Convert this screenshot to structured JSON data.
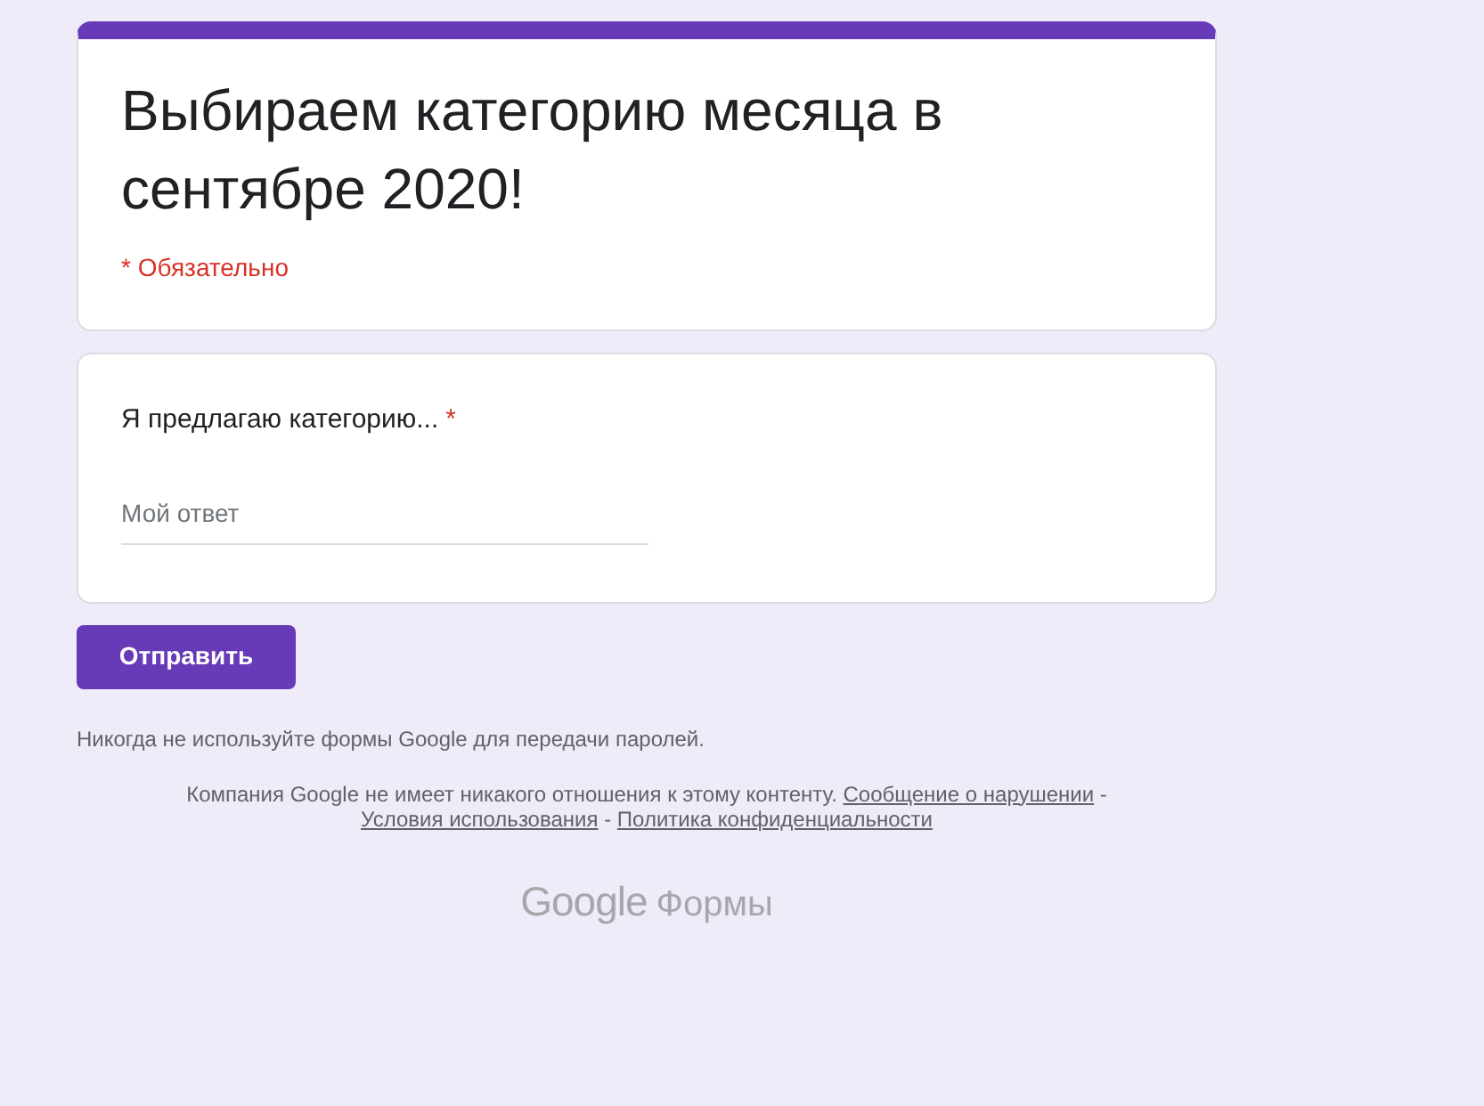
{
  "header": {
    "title": "Выбираем категорию месяца в сентябре 2020!",
    "required_note": "* Обязательно"
  },
  "questions": [
    {
      "label": "Я предлагаю категорию...",
      "required_mark": "*",
      "placeholder": "Мой ответ"
    }
  ],
  "submit_button": "Отправить",
  "password_warning": "Никогда не используйте формы Google для передачи паролей.",
  "legal": [
    {
      "kind": "text",
      "text": "Компания Google не имеет никакого отношения к этому контенту."
    },
    {
      "kind": "link",
      "text": "Сообщение о нарушении"
    },
    {
      "kind": "text",
      "text": "-"
    },
    {
      "kind": "link",
      "text": "Условия использования"
    },
    {
      "kind": "text",
      "text": "-"
    },
    {
      "kind": "link",
      "text": "Политика конфиденциальности"
    }
  ],
  "logo": {
    "brand": "Google",
    "product": "Формы"
  }
}
